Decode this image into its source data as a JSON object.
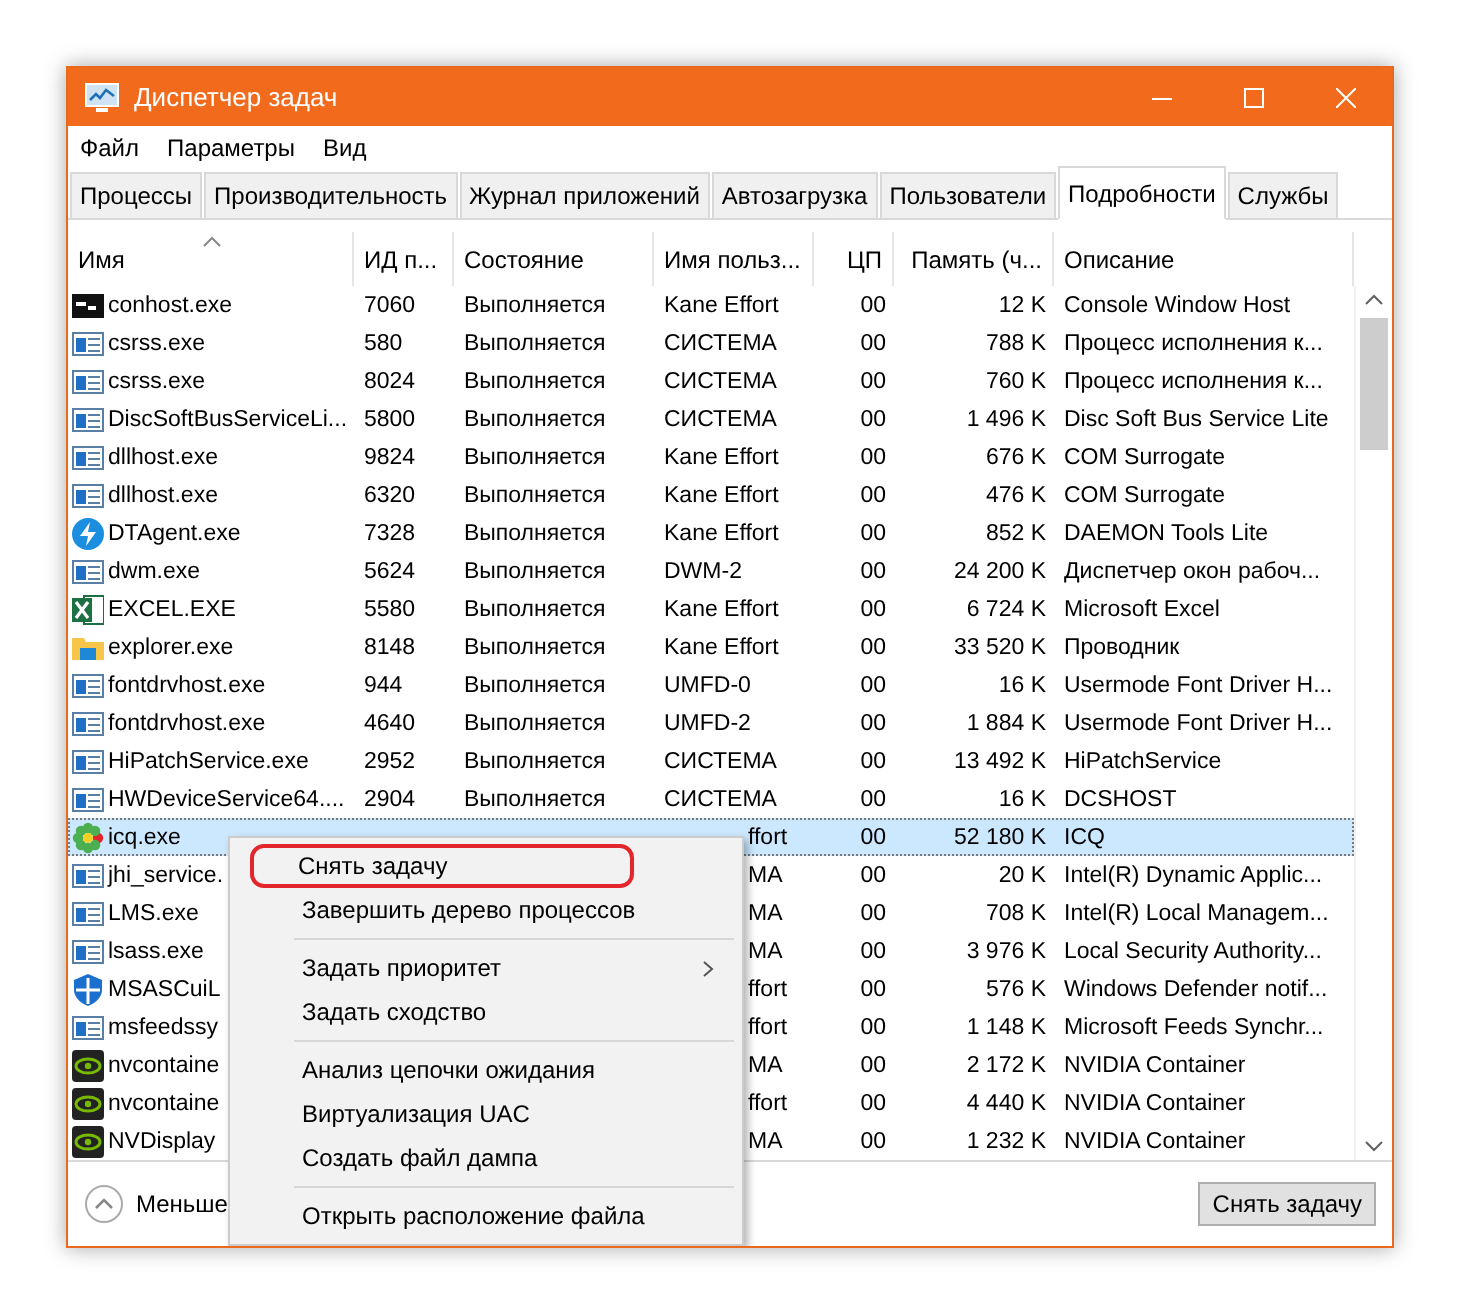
{
  "window": {
    "title": "Диспетчер задач"
  },
  "menu": [
    "Файл",
    "Параметры",
    "Вид"
  ],
  "tabs": [
    {
      "label": "Процессы",
      "selected": false
    },
    {
      "label": "Производительность",
      "selected": false
    },
    {
      "label": "Журнал приложений",
      "selected": false
    },
    {
      "label": "Автозагрузка",
      "selected": false
    },
    {
      "label": "Пользователи",
      "selected": false
    },
    {
      "label": "Подробности",
      "selected": true
    },
    {
      "label": "Службы",
      "selected": false
    }
  ],
  "table": {
    "columns": [
      "Имя",
      "ИД п...",
      "Состояние",
      "Имя польз...",
      "ЦП",
      "Память (ч...",
      "Описание"
    ],
    "rows": [
      {
        "kind": "console",
        "name": "conhost.exe",
        "id": "7060",
        "state": "Выполняется",
        "user": "Kane Effort",
        "cpu": "00",
        "memory": "12 K",
        "description": "Console Window Host",
        "selected": false
      },
      {
        "kind": "window",
        "name": "csrss.exe",
        "id": "580",
        "state": "Выполняется",
        "user": "СИСТЕМА",
        "cpu": "00",
        "memory": "788 K",
        "description": "Процесс исполнения к...",
        "selected": false
      },
      {
        "kind": "window",
        "name": "csrss.exe",
        "id": "8024",
        "state": "Выполняется",
        "user": "СИСТЕМА",
        "cpu": "00",
        "memory": "760 K",
        "description": "Процесс исполнения к...",
        "selected": false
      },
      {
        "kind": "window",
        "name": "DiscSoftBusServiceLi...",
        "id": "5800",
        "state": "Выполняется",
        "user": "СИСТЕМА",
        "cpu": "00",
        "memory": "1 496 K",
        "description": "Disc Soft Bus Service Lite",
        "selected": false
      },
      {
        "kind": "window",
        "name": "dllhost.exe",
        "id": "9824",
        "state": "Выполняется",
        "user": "Kane Effort",
        "cpu": "00",
        "memory": "676 K",
        "description": "COM Surrogate",
        "selected": false
      },
      {
        "kind": "window",
        "name": "dllhost.exe",
        "id": "6320",
        "state": "Выполняется",
        "user": "Kane Effort",
        "cpu": "00",
        "memory": "476 K",
        "description": "COM Surrogate",
        "selected": false
      },
      {
        "kind": "bolt",
        "name": "DTAgent.exe",
        "id": "7328",
        "state": "Выполняется",
        "user": "Kane Effort",
        "cpu": "00",
        "memory": "852 K",
        "description": "DAEMON Tools Lite",
        "selected": false
      },
      {
        "kind": "window",
        "name": "dwm.exe",
        "id": "5624",
        "state": "Выполняется",
        "user": "DWM-2",
        "cpu": "00",
        "memory": "24 200 K",
        "description": "Диспетчер окон рабоч...",
        "selected": false
      },
      {
        "kind": "sheet",
        "name": "EXCEL.EXE",
        "id": "5580",
        "state": "Выполняется",
        "user": "Kane Effort",
        "cpu": "00",
        "memory": "6 724 K",
        "description": "Microsoft Excel",
        "selected": false
      },
      {
        "kind": "folder",
        "name": "explorer.exe",
        "id": "8148",
        "state": "Выполняется",
        "user": "Kane Effort",
        "cpu": "00",
        "memory": "33 520 K",
        "description": "Проводник",
        "selected": false
      },
      {
        "kind": "window",
        "name": "fontdrvhost.exe",
        "id": "944",
        "state": "Выполняется",
        "user": "UMFD-0",
        "cpu": "00",
        "memory": "16 K",
        "description": "Usermode Font Driver H...",
        "selected": false
      },
      {
        "kind": "window",
        "name": "fontdrvhost.exe",
        "id": "4640",
        "state": "Выполняется",
        "user": "UMFD-2",
        "cpu": "00",
        "memory": "1 884 K",
        "description": "Usermode Font Driver H...",
        "selected": false
      },
      {
        "kind": "window",
        "name": "HiPatchService.exe",
        "id": "2952",
        "state": "Выполняется",
        "user": "СИСТЕМА",
        "cpu": "00",
        "memory": "13 492 K",
        "description": "HiPatchService",
        "selected": false
      },
      {
        "kind": "window",
        "name": "HWDeviceService64....",
        "id": "2904",
        "state": "Выполняется",
        "user": "СИСТЕМА",
        "cpu": "00",
        "memory": "16 K",
        "description": "DCSHOST",
        "selected": false
      },
      {
        "kind": "flower",
        "name": "icq.exe",
        "user": "ffort",
        "cpu": "00",
        "memory": "52 180 K",
        "description": "ICQ",
        "selected": true
      },
      {
        "kind": "window",
        "name": "jhi_service.",
        "user": "МА",
        "cpu": "00",
        "memory": "20 K",
        "description": "Intel(R) Dynamic Applic...",
        "selected": false
      },
      {
        "kind": "window",
        "name": "LMS.exe",
        "user": "МА",
        "cpu": "00",
        "memory": "708 K",
        "description": "Intel(R) Local Managem...",
        "selected": false
      },
      {
        "kind": "window",
        "name": "lsass.exe",
        "user": "МА",
        "cpu": "00",
        "memory": "3 976 K",
        "description": "Local Security Authority...",
        "selected": false
      },
      {
        "kind": "shield",
        "name": "MSASCuiL",
        "user": "ffort",
        "cpu": "00",
        "memory": "576 K",
        "description": "Windows Defender notif...",
        "selected": false
      },
      {
        "kind": "window",
        "name": "msfeedssy",
        "user": "ffort",
        "cpu": "00",
        "memory": "1 148 K",
        "description": "Microsoft Feeds Synchr...",
        "selected": false
      },
      {
        "kind": "eye",
        "name": "nvcontaine",
        "user": "МА",
        "cpu": "00",
        "memory": "2 172 K",
        "description": "NVIDIA Container",
        "selected": false
      },
      {
        "kind": "eye",
        "name": "nvcontaine",
        "user": "ffort",
        "cpu": "00",
        "memory": "4 440 K",
        "description": "NVIDIA Container",
        "selected": false
      },
      {
        "kind": "eye",
        "name": "NVDisplay",
        "user": "МА",
        "cpu": "00",
        "memory": "1 232 K",
        "description": "NVIDIA Container",
        "selected": false
      }
    ]
  },
  "context_menu": {
    "items": [
      {
        "kind": "item",
        "label": "Снять задачу",
        "highlighted": true
      },
      {
        "kind": "item",
        "label": "Завершить дерево процессов",
        "highlighted": false
      },
      {
        "kind": "separator"
      },
      {
        "kind": "submenu",
        "label": "Задать приоритет",
        "highlighted": false
      },
      {
        "kind": "item",
        "label": "Задать сходство",
        "highlighted": false
      },
      {
        "kind": "separator"
      },
      {
        "kind": "item",
        "label": "Анализ цепочки ожидания",
        "highlighted": false
      },
      {
        "kind": "item",
        "label": "Виртуализация UAC",
        "highlighted": false
      },
      {
        "kind": "item",
        "label": "Создать файл дампа",
        "highlighted": false
      },
      {
        "kind": "separator"
      },
      {
        "kind": "item",
        "label": "Открыть расположение файла",
        "highlighted": false
      }
    ]
  },
  "footer": {
    "details_toggle": "Меньше",
    "end_task_button": "Снять задачу"
  }
}
